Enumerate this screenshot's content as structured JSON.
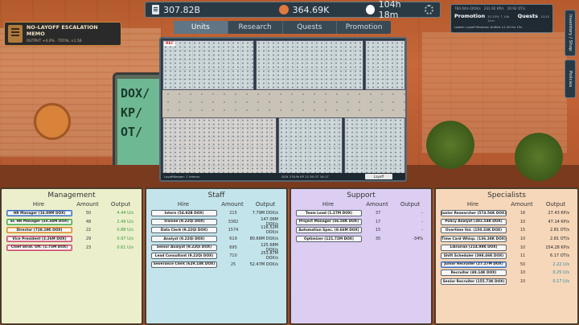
{
  "resources": {
    "documents": "307.82B",
    "money": "364.69K",
    "time": "104h 18m"
  },
  "tabs": [
    {
      "label": "Units",
      "active": true
    },
    {
      "label": "Research",
      "active": false
    },
    {
      "label": "Quests",
      "active": false
    },
    {
      "label": "Promotion",
      "active": false
    }
  ],
  "memo": {
    "title": "NO-LAYOFF ESCALATION MEMO",
    "subtitle": "OUTPUT +4.0%  ·  TOTAL ×1.56"
  },
  "info": {
    "stat_rate": "784.04m DOX/s",
    "stat_kps": "231.92 KP/s",
    "stat_ot": "10.92 OT/s",
    "promotion_label": "Promotion",
    "promotion_value": "32.33% ↑ 10h 11m",
    "quests_label": "Quests",
    "quests_value": "11/15",
    "latest": "Latest: Layoff Mantras: buffed ×1.40 for 15s"
  },
  "side_tabs": {
    "inventory": "Inventory / Shop",
    "policies": "Policies"
  },
  "office": {
    "rec_label": "REC",
    "footer_left": "LayoffKeeper: 1 Interns",
    "footer_mid": "DOX 276.9t  KP 12.30  OT 16.17",
    "layoff_button": "Layoff"
  },
  "scene": {
    "monitor_text": [
      "DOX/",
      "KP/",
      "OT/"
    ]
  },
  "column_headers": {
    "hire": "Hire",
    "amount": "Amount",
    "output": "Output"
  },
  "panels": {
    "management": {
      "title": "Management",
      "rows": [
        {
          "hire": "HR Manager (16.09M DOX)",
          "amount": "50",
          "output": "4.44 U/s",
          "style": "green",
          "hl": "hi-blue"
        },
        {
          "hire": "Sr. HR Manager (33.34M DOX)",
          "amount": "48",
          "output": "2.49 U/s",
          "style": "green",
          "hl": "hi-green"
        },
        {
          "hire": "Director (728.19K DOX)",
          "amount": "22",
          "output": "0.88 U/s",
          "style": "green",
          "hl": "hi-orange"
        },
        {
          "hire": "Vice President (3.26M DOX)",
          "amount": "29",
          "output": "0.97 U/s",
          "style": "green",
          "hl": "hi-pink"
        },
        {
          "hire": "Chief Strat. Off. (1.75M DOX)",
          "amount": "23",
          "output": "0.61 U/s",
          "style": "green",
          "hl": "hi-pink"
        }
      ]
    },
    "staff": {
      "title": "Staff",
      "rows": [
        {
          "hire": "Intern (54.92B DOX)",
          "amount": "215",
          "output": "7.79M DOX/s",
          "style": "",
          "hl": ""
        },
        {
          "hire": "Trainee (9.22Qi DOX)",
          "amount": "3382",
          "output": "147.06M DOX/s",
          "style": "",
          "hl": ""
        },
        {
          "hire": "Data Clerk (9.22Qi DOX)",
          "amount": "1574",
          "output": "116.52M DOX/s",
          "style": "",
          "hl": ""
        },
        {
          "hire": "Analyst (9.22Qi DOX)",
          "amount": "619",
          "output": "80.66M DOX/s",
          "style": "",
          "hl": ""
        },
        {
          "hire": "Senior Analyst (9.22Qi DOX)",
          "amount": "695",
          "output": "125.68M DOX/s",
          "style": "",
          "hl": ""
        },
        {
          "hire": "Lead Consultant (9.22Qi DOX)",
          "amount": "710",
          "output": "253.87M DOX/s",
          "style": "",
          "hl": ""
        },
        {
          "hire": "Severance Clerk (629.18K DOX)",
          "amount": "25",
          "output": "52.47M DOX/s",
          "style": "",
          "hl": ""
        }
      ]
    },
    "support": {
      "title": "Support",
      "rows": [
        {
          "hire": "Team Lead (1.27M DOX)",
          "amount": "37",
          "output": "-",
          "style": "",
          "hl": ""
        },
        {
          "hire": "Project Manager (56.58K DOX)",
          "amount": "17",
          "output": "-",
          "style": "",
          "hl": ""
        },
        {
          "hire": "Automation Spec. (8.66M DOX)",
          "amount": "15",
          "output": "-",
          "style": "",
          "hl": ""
        },
        {
          "hire": "Optimizer (121.72M DOX)",
          "amount": "30",
          "output": "-34%",
          "style": "",
          "hl": ""
        }
      ]
    },
    "specialists": {
      "title": "Specialists",
      "rows": [
        {
          "hire": "Junior Researcher (574.56K DOX)",
          "amount": "16",
          "output": "27.43 KP/s",
          "style": "",
          "hl": ""
        },
        {
          "hire": "Policy Analyst (381.54K DOX)",
          "amount": "10",
          "output": "47.14 KP/s",
          "style": "",
          "hl": ""
        },
        {
          "hire": "Overtime Vol. (150.33K DOX)",
          "amount": "15",
          "output": "2.81 OT/s",
          "style": "",
          "hl": ""
        },
        {
          "hire": "Time Card Whisp. (136.38K DOX)",
          "amount": "10",
          "output": "2.81 OT/s",
          "style": "",
          "hl": ""
        },
        {
          "hire": "Librarian (214.98K DOX)",
          "amount": "10",
          "output": "154.28 KP/s",
          "style": "",
          "hl": ""
        },
        {
          "hire": "Shift Scheduler (398.46K DOX)",
          "amount": "11",
          "output": "6.17 OT/s",
          "style": "",
          "hl": ""
        },
        {
          "hire": "Junior Recruiter (27.27M DOX)",
          "amount": "50",
          "output": "2.22 U/s",
          "style": "teal",
          "hl": "hi-blue"
        },
        {
          "hire": "Recruiter (49.14K DOX)",
          "amount": "10",
          "output": "0.25 U/s",
          "style": "teal",
          "hl": ""
        },
        {
          "hire": "Senior Recruiter (155.73K DOX)",
          "amount": "10",
          "output": "0.17 U/s",
          "style": "teal",
          "hl": ""
        }
      ]
    }
  }
}
